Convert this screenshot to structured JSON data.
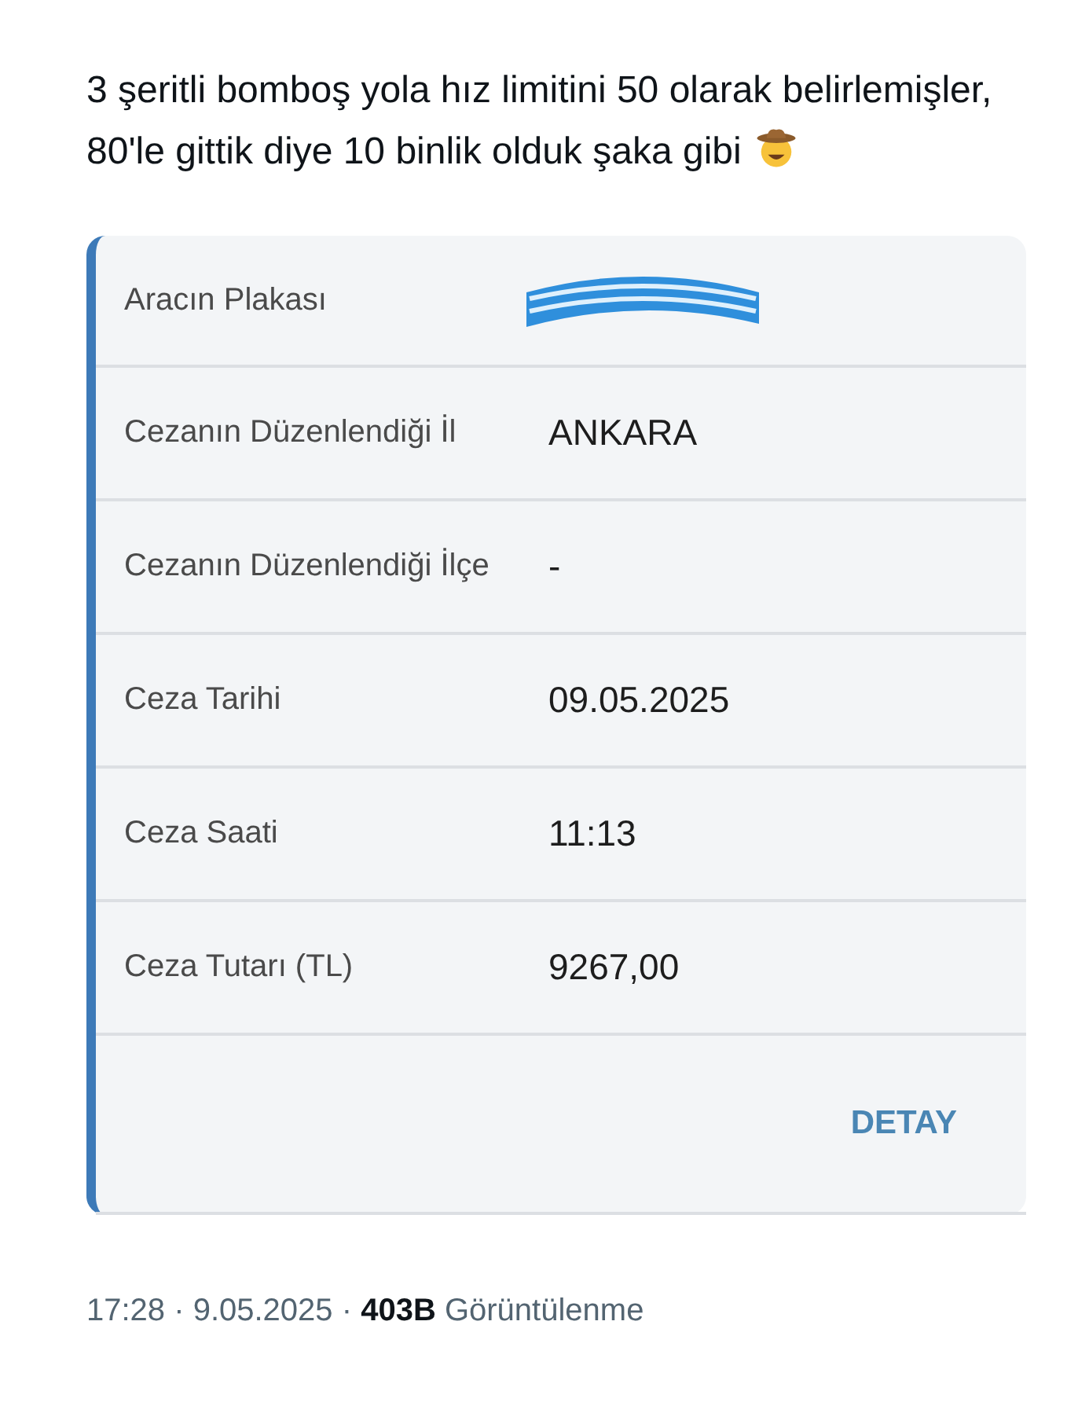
{
  "post": {
    "text": "3 şeritli bomboş yola hız limitini 50 olarak belirlemişler, 80'le gittik diye 10 binlik olduk şaka gibi"
  },
  "card": {
    "rows": [
      {
        "label": "Aracın Plakası",
        "kind": "redacted"
      },
      {
        "label": "Cezanın Düzenlendiği İl",
        "kind": "text",
        "value": "ANKARA"
      },
      {
        "label": "Cezanın Düzenlendiği İlçe",
        "kind": "text",
        "value": "-"
      },
      {
        "label": "Ceza Tarihi",
        "kind": "text",
        "value": "09.05.2025"
      },
      {
        "label": "Ceza Saati",
        "kind": "text",
        "value": "11:13"
      },
      {
        "label": "Ceza Tutarı (TL)",
        "kind": "text",
        "value": "9267,00"
      }
    ],
    "action": "DETAY"
  },
  "meta": "17:28 · 9.05.2025 · **403B** Görüntülenme"
}
